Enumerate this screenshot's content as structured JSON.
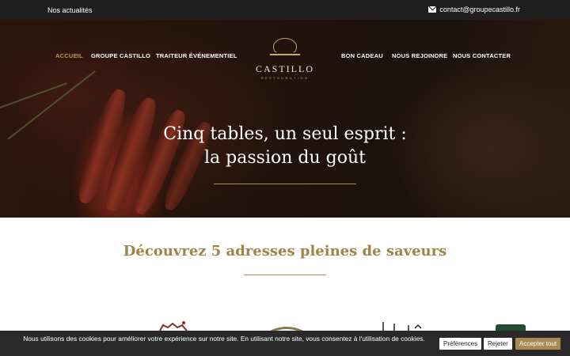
{
  "topbar": {
    "news_label": "Nos actualités",
    "contact_email": "contact@groupecastillo.fr",
    "mail_icon": "envelope-icon"
  },
  "nav": {
    "items": [
      {
        "label": "ACCUEIL",
        "active": true
      },
      {
        "label": "GROUPE CASTILLO",
        "active": false
      },
      {
        "label": "TRAITEUR ÉVÉNEMENTIEL",
        "active": false
      },
      {
        "label": "BON CADEAU",
        "active": false
      },
      {
        "label": "NOUS REJOINDRE",
        "active": false
      },
      {
        "label": "NOUS CONTACTER",
        "active": false
      }
    ]
  },
  "logo": {
    "name": "CASTILLO",
    "tagline": "RESTAURATION"
  },
  "hero": {
    "title_line1": "Cinq tables, un seul esprit :",
    "title_line2": "la passion du goût"
  },
  "section": {
    "title": "Découvrez 5 adresses pleines de saveurs"
  },
  "cookie": {
    "message": "Nous utilisons des cookies pour améliorer votre expérience sur notre site. En utilisant notre site, vous consentez à l'utilisation de cookies.",
    "preferences_label": "Préférences",
    "reject_label": "Rejeter",
    "accept_label": "Accepter tout"
  },
  "colors": {
    "gold": "#a88a52",
    "dark": "#1e1e1e",
    "cookie_bg": "#2a2a2a"
  }
}
